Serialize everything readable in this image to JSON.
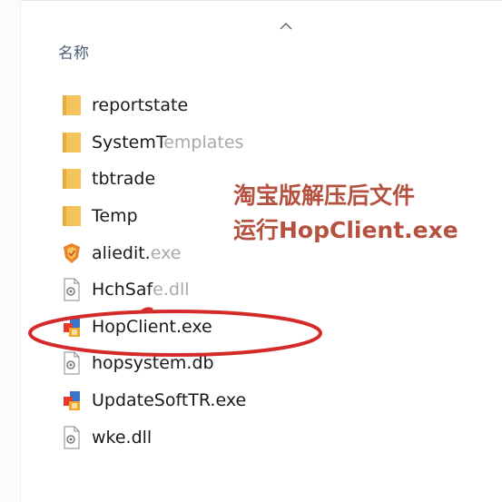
{
  "header": {
    "column_name": "名称"
  },
  "files": [
    {
      "icon": "folder-icon",
      "name": "reportstate",
      "ext": ""
    },
    {
      "icon": "folder-icon",
      "name": "SystemT",
      "ext": "emplates"
    },
    {
      "icon": "folder-icon",
      "name": "tbtrade",
      "ext": ""
    },
    {
      "icon": "folder-icon",
      "name": "Temp",
      "ext": ""
    },
    {
      "icon": "shield-app-icon",
      "name": "aliedit.",
      "ext": "exe"
    },
    {
      "icon": "dll-file-icon",
      "name": "HchSaf",
      "ext": "e.dll"
    },
    {
      "icon": "app-exe-icon",
      "name": "HopClient.exe",
      "ext": ""
    },
    {
      "icon": "db-file-icon",
      "name": "hopsystem.db",
      "ext": ""
    },
    {
      "icon": "app-exe-icon",
      "name": "UpdateSoftTR.exe",
      "ext": ""
    },
    {
      "icon": "dll-file-icon",
      "name": "wke.dll",
      "ext": ""
    }
  ],
  "annotation": {
    "line1": "淘宝版解压后文件",
    "line2": "运行HopClient.exe",
    "color": "#b5523f"
  },
  "colors": {
    "folder": "#f4c35a",
    "highlight_ellipse": "#d42a2a",
    "header_text": "#4c607a"
  }
}
